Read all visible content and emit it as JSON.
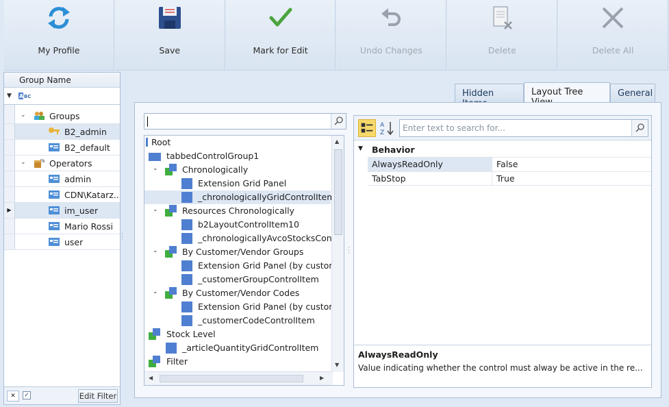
{
  "toolbar": {
    "buttons": [
      {
        "label": "My Profile",
        "icon": "refresh-icon",
        "enabled": true
      },
      {
        "label": "Save",
        "icon": "floppy-disk-icon",
        "enabled": true
      },
      {
        "label": "Mark for Edit",
        "icon": "checkmark-icon",
        "enabled": true
      },
      {
        "label": "Undo Changes",
        "icon": "undo-arrow-icon",
        "enabled": false
      },
      {
        "label": "Delete",
        "icon": "delete-document-icon",
        "enabled": false
      },
      {
        "label": "Delete All",
        "icon": "x-icon",
        "enabled": false
      }
    ]
  },
  "group_grid": {
    "column_header": "Group Name",
    "rows": [
      {
        "label": "Groups",
        "type": "category",
        "expanded": true
      },
      {
        "label": "B2_admin",
        "type": "item",
        "icon": "key-icon",
        "selected": true
      },
      {
        "label": "B2_default",
        "type": "item",
        "icon": "card-icon"
      },
      {
        "label": "Operators",
        "type": "category",
        "expanded": true
      },
      {
        "label": "admin",
        "type": "item",
        "icon": "card-icon"
      },
      {
        "label": "CDN\\Katarz...",
        "type": "item",
        "icon": "card-icon"
      },
      {
        "label": "im_user",
        "type": "item",
        "icon": "card-icon",
        "current": true
      },
      {
        "label": "Mario Rossi",
        "type": "item",
        "icon": "card-icon"
      },
      {
        "label": "user",
        "type": "item",
        "icon": "card-icon"
      }
    ],
    "edit_filter_label": "Edit Filter"
  },
  "tabs": [
    {
      "label": "Hidden Items",
      "active": false
    },
    {
      "label": "Layout Tree View",
      "active": true
    },
    {
      "label": "General",
      "active": false
    }
  ],
  "tree": {
    "search_value": "",
    "nodes": [
      "Root",
      "tabbedControlGroup1",
      "Chronologically",
      "Extension Grid Panel",
      "_chronologicallyGridControlItem",
      "Resources Chronologically",
      "b2LayoutControlItem10",
      "_chronologicallyAvcoStocksControlItem",
      "By Customer/Vendor Groups",
      "Extension Grid Panel (by customer groups)",
      "_customerGroupControlItem",
      "By Customer/Vendor Codes",
      "Extension Grid Panel (by customer codes)",
      "_customerCodeControlItem",
      "Stock Level",
      "_articleQuantityGridControlItem",
      "Filter"
    ]
  },
  "property_grid": {
    "search_placeholder": "Enter text to search for...",
    "category": "Behavior",
    "properties": [
      {
        "name": "AlwaysReadOnly",
        "value": "False"
      },
      {
        "name": "TabStop",
        "value": "True"
      }
    ],
    "description_title": "AlwaysReadOnly",
    "description_text": "Value indicating whether the control must alway be active in the re..."
  },
  "colors": {
    "background": "#dfe9f5",
    "accent_blue": "#4f7fd0",
    "accent_green": "#3fae3f",
    "selection": "#dde7f4"
  }
}
